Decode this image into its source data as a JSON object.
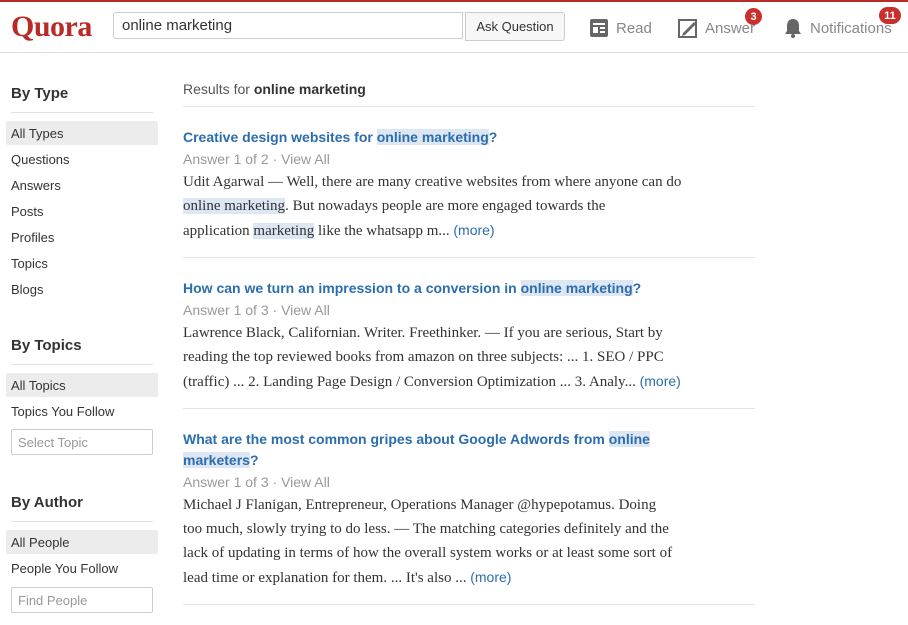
{
  "header": {
    "logo": "Quora",
    "search_value": "online marketing",
    "ask_label": "Ask Question",
    "nav": {
      "read": "Read",
      "answer": "Answer",
      "answer_badge": "3",
      "notifications": "Notifications",
      "notifications_badge": "11"
    }
  },
  "sidebar": {
    "by_type": {
      "heading": "By Type",
      "items": [
        "All Types",
        "Questions",
        "Answers",
        "Posts",
        "Profiles",
        "Topics",
        "Blogs"
      ]
    },
    "by_topics": {
      "heading": "By Topics",
      "items": [
        "All Topics",
        "Topics You Follow"
      ],
      "placeholder": "Select Topic"
    },
    "by_author": {
      "heading": "By Author",
      "items": [
        "All People",
        "People You Follow"
      ],
      "placeholder": "Find People"
    }
  },
  "results": {
    "prefix": "Results for",
    "query": "online marketing",
    "items": [
      {
        "q1": "Creative design websites  for ",
        "q2": "online marketing",
        "q3": "?",
        "meta": "Answer 1 of 2",
        "view_all": "View All",
        "l1": "Udit Agarwal — Well, there are many creative websites from where anyone can do",
        "l2a": "online marketing",
        "l2b": ". But nowadays people are more engaged towards the",
        "l3a": "application ",
        "l3b": "marketing",
        "l3c": " like the whatsapp m... ",
        "more": "(more)"
      },
      {
        "q1": "How can we turn an impression to a conversion in ",
        "q2": "online marketing",
        "q3": "?",
        "meta": "Answer 1 of 3",
        "view_all": "View All",
        "l1": "Lawrence Black, Californian. Writer. Freethinker. — If you are serious, Start by",
        "l2": "reading the top reviewed books from amazon on three subjects: ... 1. SEO / PPC",
        "l3": "(traffic) ... 2. Landing Page Design / Conversion Optimization ... 3. Analy... ",
        "more": "(more)"
      },
      {
        "q1": "What are the most common  gripes about Google Adwords from ",
        "q2": "online",
        "q3": "marketers",
        "q4": "?",
        "meta": "Answer 1 of 3",
        "view_all": "View All",
        "l1": "Michael J Flanigan, Entrepreneur, Operations Manager @hypepotamus. Doing",
        "l2": "too much, slowly trying to do less.  —  The matching categories definitely and the",
        "l3": "lack of updating in terms of how the overall system works or at least some sort of",
        "l4": "lead time or explanation for them.  ... It's also ... ",
        "more": "(more)"
      }
    ]
  }
}
